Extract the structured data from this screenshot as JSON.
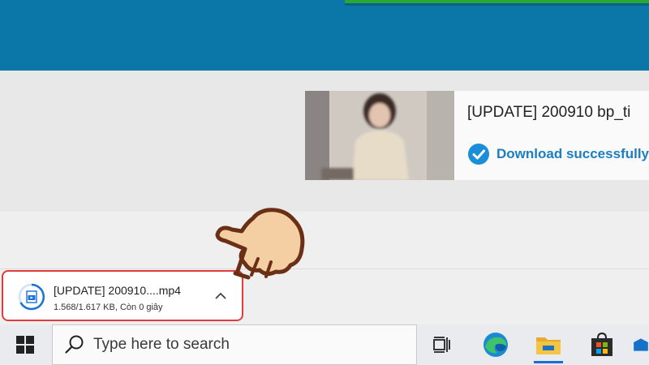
{
  "result": {
    "title": "[UPDATE] 200910 bp_ti",
    "status": "Download successfully"
  },
  "download": {
    "file_name": "[UPDATE] 200910....mp4",
    "progress_text": "1.568/1.617 KB, Còn 0 giây"
  },
  "taskbar": {
    "search_placeholder": "Type here to search",
    "icons": [
      "windows-start-icon",
      "search-icon",
      "task-view-icon",
      "edge-icon",
      "file-explorer-icon",
      "store-icon",
      "mail-icon"
    ]
  },
  "colors": {
    "header": "#0b76a8",
    "accent_link": "#1a7fc1",
    "highlight_border": "#e23b3b",
    "taskbar": "#e9ebef"
  }
}
